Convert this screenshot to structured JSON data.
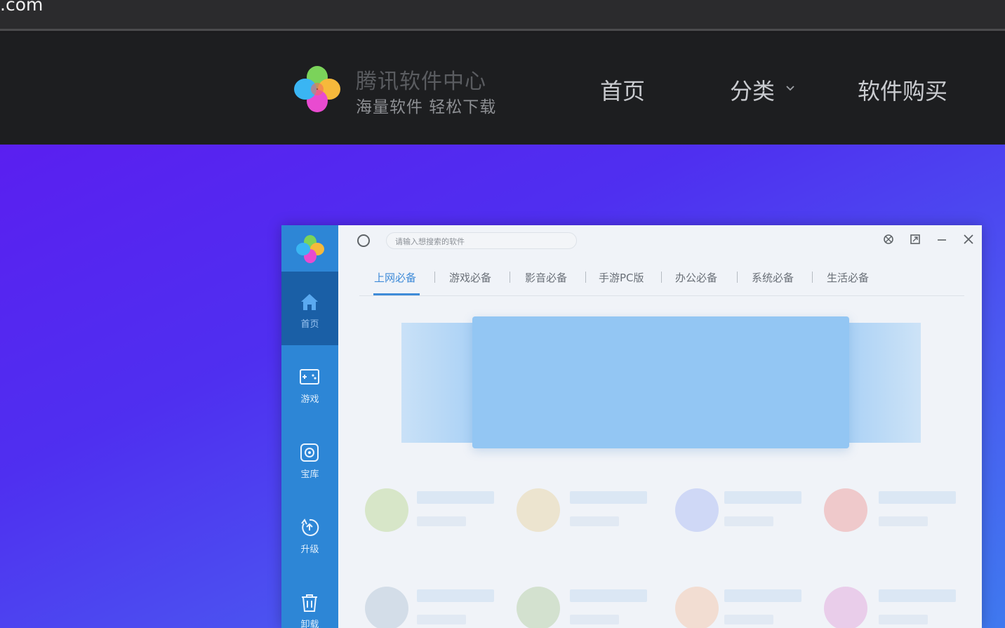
{
  "browser": {
    "address_fragment": ".com"
  },
  "header": {
    "brand_title": "腾讯软件中心",
    "brand_subtitle": "海量软件 轻松下载",
    "nav": {
      "home": "首页",
      "category": "分类",
      "buy": "软件购买"
    }
  },
  "app_window": {
    "search_placeholder": "请输入想搜索的软件",
    "sidebar": [
      {
        "label": "首页",
        "icon": "home-icon",
        "active": true
      },
      {
        "label": "游戏",
        "icon": "gamepad-icon",
        "active": false
      },
      {
        "label": "宝库",
        "icon": "treasure-icon",
        "active": false
      },
      {
        "label": "升级",
        "icon": "upgrade-icon",
        "active": false
      },
      {
        "label": "卸载",
        "icon": "trash-icon",
        "active": false
      }
    ],
    "tabs": [
      "上网必备",
      "游戏必备",
      "影音必备",
      "手游PC版",
      "办公必备",
      "系统必备",
      "生活必备"
    ],
    "active_tab": "上网必备"
  },
  "colors": {
    "hero_start": "#5a1ff0",
    "hero_end": "#3f79ef",
    "sidebar": "#2d86d6",
    "accent": "#3f8bd8"
  }
}
